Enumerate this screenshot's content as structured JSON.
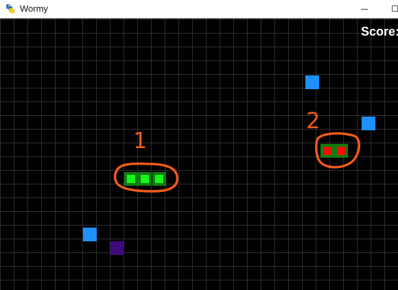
{
  "window": {
    "title": "Wormy",
    "app_icon": "python-icon"
  },
  "hud": {
    "score_label": "Score:"
  },
  "annotations": {
    "worm_1_label": "1",
    "worm_2_label": "2"
  },
  "colors": {
    "background": "#000000",
    "grid": "#2f2f2f",
    "worm_outer": "#117c10",
    "worm_1_inner": "#18f51c",
    "worm_2_inner": "#ff0a0a",
    "blue_square": "#1e90ff",
    "purple_square": "#3d0a7a",
    "annotation": "#f05a1a"
  }
}
